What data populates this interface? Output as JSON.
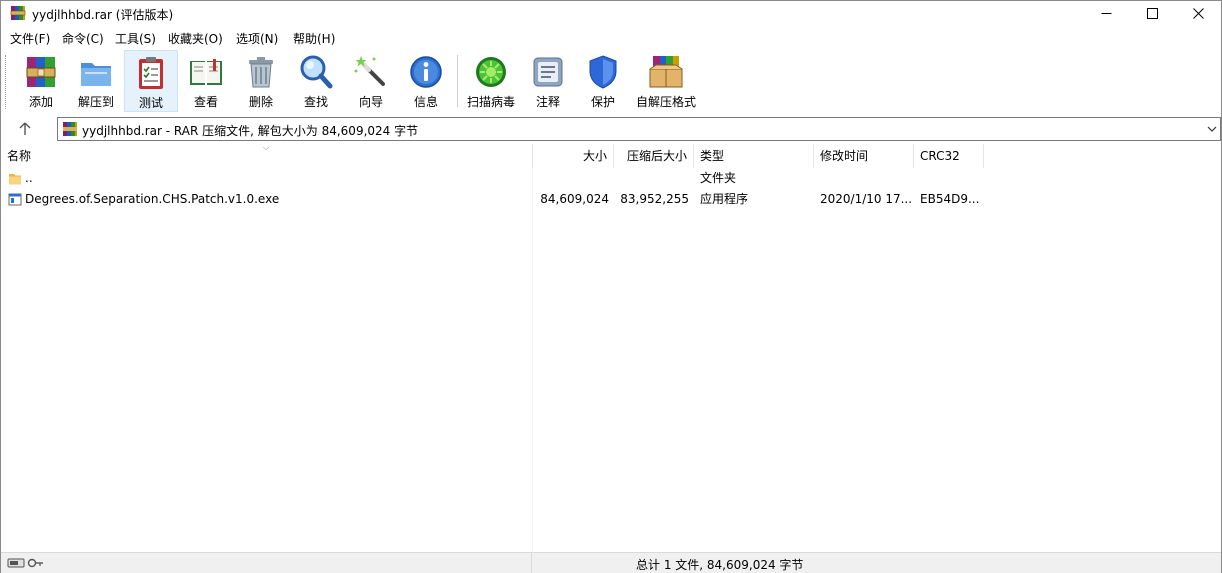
{
  "window": {
    "title": "yydjlhhbd.rar (评估版本)",
    "controls": {
      "minimize": "minimize",
      "maximize": "maximize",
      "close": "close"
    }
  },
  "menu": [
    {
      "label": "文件(F)"
    },
    {
      "label": "命令(C)"
    },
    {
      "label": "工具(S)"
    },
    {
      "label": "收藏夹(O)"
    },
    {
      "label": "选项(N)"
    },
    {
      "label": "帮助(H)"
    }
  ],
  "toolbar": [
    {
      "label": "添加",
      "icon": "add-archive-icon"
    },
    {
      "label": "解压到",
      "icon": "extract-folder-icon"
    },
    {
      "label": "测试",
      "icon": "test-clipboard-icon"
    },
    {
      "label": "查看",
      "icon": "view-book-icon"
    },
    {
      "label": "删除",
      "icon": "trash-icon"
    },
    {
      "label": "查找",
      "icon": "magnifier-icon"
    },
    {
      "label": "向导",
      "icon": "wizard-wand-icon"
    },
    {
      "label": "信息",
      "icon": "info-icon"
    },
    {
      "label": "扫描病毒",
      "icon": "virus-scan-icon"
    },
    {
      "label": "注释",
      "icon": "comment-icon"
    },
    {
      "label": "保护",
      "icon": "shield-icon"
    },
    {
      "label": "自解压格式",
      "icon": "sfx-box-icon"
    }
  ],
  "address": {
    "text": "yydjlhhbd.rar - RAR 压缩文件, 解包大小为 84,609,024 字节"
  },
  "columns": {
    "name": "名称",
    "size": "大小",
    "packed": "压缩后大小",
    "type": "类型",
    "modified": "修改时间",
    "crc": "CRC32"
  },
  "rows": [
    {
      "name": "..",
      "size": "",
      "packed": "",
      "type": "文件夹",
      "modified": "",
      "crc": ""
    },
    {
      "name": "Degrees.of.Separation.CHS.Patch.v1.0.exe",
      "size": "84,609,024",
      "packed": "83,952,255",
      "type": "应用程序",
      "modified": "2020/1/10 17...",
      "crc": "EB54D9..."
    }
  ],
  "status": {
    "summary": "总计 1 文件, 84,609,024 字节"
  },
  "colors": {
    "accent": "#e5f1fb",
    "border": "#7a7a7a",
    "status_bg": "#f0f0f0"
  }
}
